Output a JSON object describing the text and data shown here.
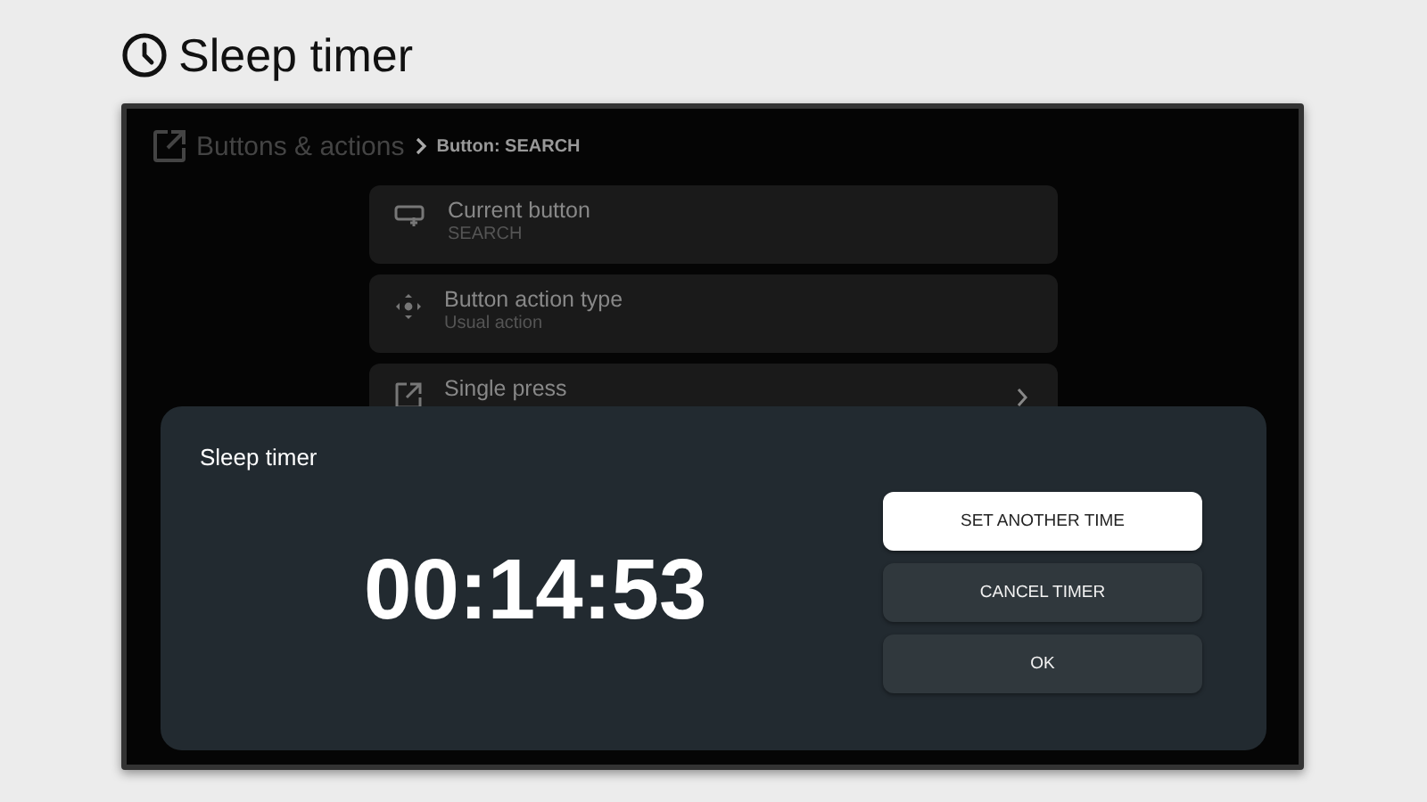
{
  "page_title": "Sleep timer",
  "breadcrumb": {
    "parent": "Buttons & actions",
    "current": "Button: SEARCH"
  },
  "items": [
    {
      "kind": "button",
      "title": "Current button",
      "subtitle": "SEARCH",
      "chevron": false
    },
    {
      "kind": "move",
      "title": "Button action type",
      "subtitle": "Usual action",
      "chevron": false
    },
    {
      "kind": "open",
      "title": "Single press",
      "chevron": true
    }
  ],
  "dialog": {
    "title": "Sleep timer",
    "time": "00:14:53",
    "buttons": [
      {
        "label": "SET ANOTHER TIME",
        "selected": true
      },
      {
        "label": "CANCEL TIMER",
        "selected": false
      },
      {
        "label": "OK",
        "selected": false
      }
    ]
  }
}
